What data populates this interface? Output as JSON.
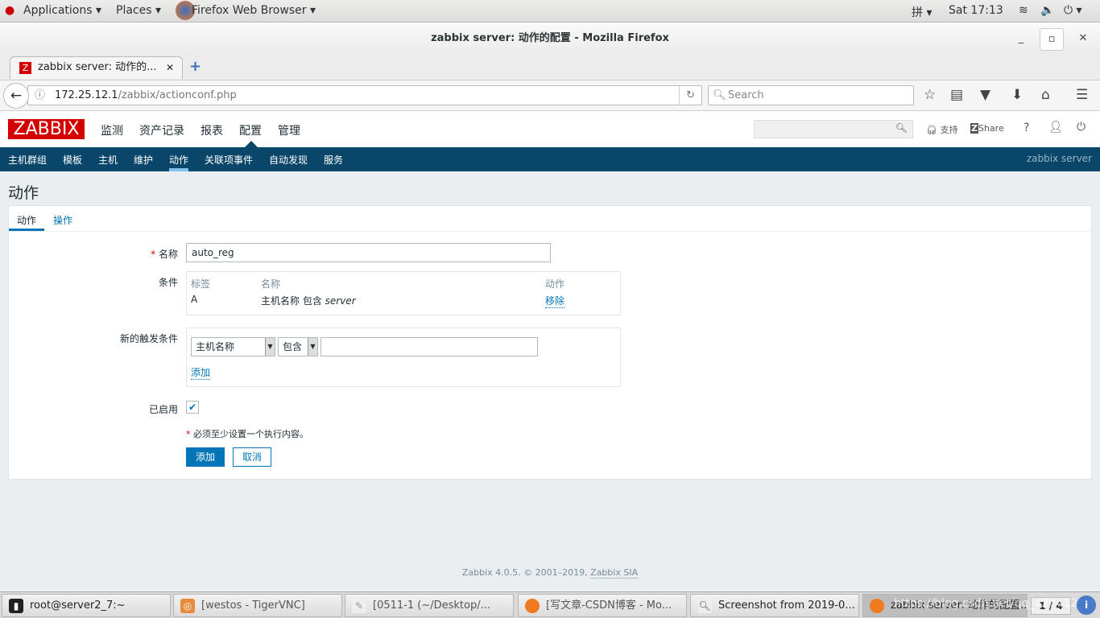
{
  "gnome": {
    "applications": "Applications",
    "places": "Places",
    "app": "Firefox Web Browser",
    "ime": "拼",
    "clock": "Sat 17:13"
  },
  "firefox": {
    "window_title": "zabbix server: 动作的配置 - Mozilla Firefox",
    "tab_title": "zabbix server: 动作的...",
    "url_host": "172.25.12.1",
    "url_path": "/zabbix/actionconf.php",
    "search_placeholder": "Search"
  },
  "zabbix": {
    "logo": "ZABBIX",
    "menu": [
      "监测",
      "资产记录",
      "报表",
      "配置",
      "管理"
    ],
    "active_menu": "配置",
    "header_links": {
      "support": "支持",
      "share": "Share",
      "help": "?"
    },
    "submenu": [
      "主机群组",
      "模板",
      "主机",
      "维护",
      "动作",
      "关联项事件",
      "自动发现",
      "服务"
    ],
    "active_submenu": "动作",
    "server_name": "zabbix server",
    "page_title": "动作",
    "tabs": [
      "动作",
      "操作"
    ],
    "form": {
      "name_label": "名称",
      "name_value": "auto_reg",
      "conditions_label": "条件",
      "conditions_headers": [
        "标签",
        "名称",
        "动作"
      ],
      "conditions": [
        {
          "label": "A",
          "name_prefix": "主机名称 包含 ",
          "name_value": "server",
          "action": "移除"
        }
      ],
      "new_condition_label": "新的触发条件",
      "new_condition_type": "主机名称",
      "new_condition_operator": "包含",
      "new_condition_value": "",
      "add_link": "添加",
      "enabled_label": "已启用",
      "enabled": true,
      "warning": "必须至少设置一个执行内容。",
      "submit": "添加",
      "cancel": "取消"
    },
    "footer_text": "Zabbix 4.0.5. © 2001–2019, ",
    "footer_link": "Zabbix SIA"
  },
  "taskbar": {
    "items": [
      "root@server2_7:~",
      "[westos - TigerVNC]",
      "[0511-1 (~/Desktop/...",
      "[写文章-CSDN博客 - Mo...",
      "Screenshot from 2019-0...",
      "zabbix server: 动作的配置..."
    ],
    "pager": "1 / 4",
    "watermark": "https://blog.csdn.net/qq_42741201"
  }
}
